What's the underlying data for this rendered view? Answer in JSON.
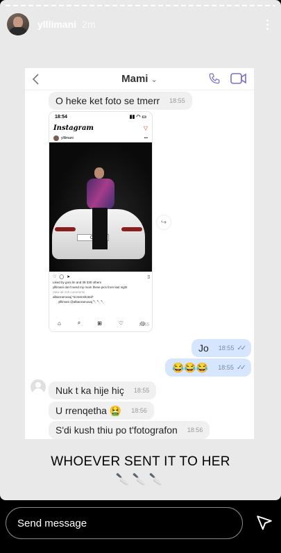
{
  "story": {
    "username": "ylllimani",
    "time": "2m",
    "caption": "WHOEVER SENT IT TO HER",
    "caption_emoji": "🔪🔪🔪"
  },
  "chat": {
    "contact_name": "Mami",
    "contact_chevron": "⌄",
    "messages": [
      {
        "text": "O heke ket foto se tmerr",
        "time": "18:55",
        "dir": "in"
      },
      {
        "text": "Jo",
        "time": "18:55",
        "dir": "out"
      },
      {
        "text": "😂😂😂",
        "time": "18:55",
        "dir": "out"
      },
      {
        "text": "Nuk t ka hije hiç",
        "time": "18:55",
        "dir": "in"
      },
      {
        "text": "U rrenqetha 🤮",
        "time": "18:56",
        "dir": "in"
      },
      {
        "text": "S'di kush thiu po t'fotografon",
        "time": "18:56",
        "dir": "in"
      }
    ],
    "screenshot": {
      "status_time": "18:54",
      "app_name": "Instagram",
      "post_user": "ylllimani",
      "plate": "01",
      "likes": "Liked by goni.lm and 39 330 others",
      "post_caption": "ylllimani don't send my mom these pics from last night",
      "comments_link": "View all 415 comments",
      "comment_1": "albanramosaj *screenshoted*",
      "comment_2": "ylllimani @albanramosaj 🔪🔪🔪",
      "stamp": "18:55"
    }
  },
  "reply": {
    "placeholder": "Send message"
  },
  "icons": [
    "more-icon",
    "back-icon",
    "phone-icon",
    "video-call-icon",
    "share-icon",
    "send-icon"
  ]
}
